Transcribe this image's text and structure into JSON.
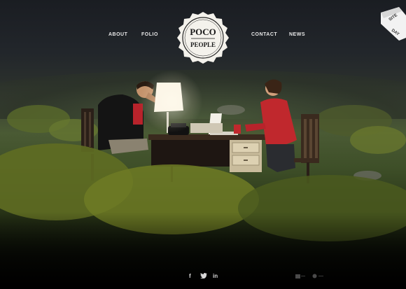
{
  "nav": {
    "about": "ABOUT",
    "folio": "FOLIO",
    "contact": "CONTACT",
    "news": "NEWS"
  },
  "logo": {
    "line1": "POCO",
    "line2": "PEOPLE"
  },
  "badge": {
    "line1": "SITE",
    "line2": "DAY"
  },
  "social": {
    "facebook": "f",
    "twitter": "t",
    "linkedin": "in"
  },
  "colors": {
    "accent_red": "#c0282d",
    "nav_text": "#e8e8e8"
  }
}
